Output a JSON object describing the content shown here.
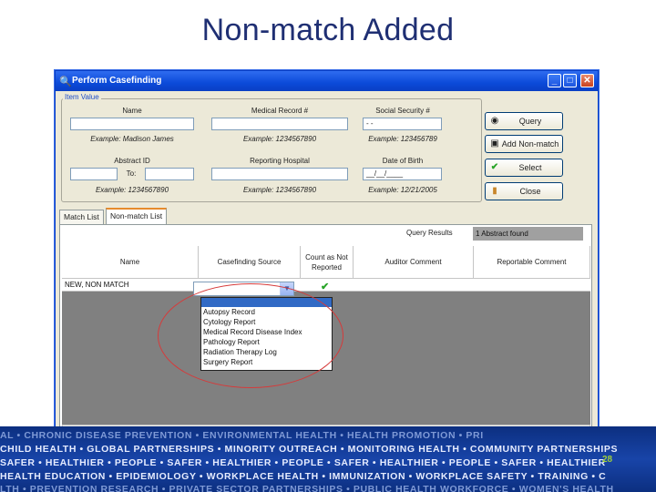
{
  "slide": {
    "title": "Non-match Added",
    "page_number": "28"
  },
  "window": {
    "title": "Perform Casefinding",
    "group_title": "Item Value",
    "labels": {
      "name": "Name",
      "medical_record": "Medical Record #",
      "social_security": "Social Security #",
      "abstract_id": "Abstract ID",
      "reporting_hospital": "Reporting Hospital",
      "date_of_birth": "Date of Birth"
    },
    "examples": {
      "name": "Example: Madison James",
      "medical_record": "Example: 1234567890",
      "social_security": "Example: 123456789",
      "abstract_id": "Example: 1234567890",
      "reporting_hospital": "Example: 1234567890",
      "date_of_birth": "Example: 12/21/2005"
    },
    "fields": {
      "name": "",
      "medical_record": "",
      "social_security": "  -  -",
      "abstract_id": "",
      "abstract_id_to_label": "To:",
      "reporting_hospital": "",
      "date_of_birth": "__/__/____"
    },
    "buttons": {
      "query": "Query",
      "add_non_match": "Add Non-match",
      "select": "Select",
      "close": "Close"
    },
    "tabs": [
      "Match List",
      "Non-match List"
    ],
    "query_results_label": "Query Results",
    "query_results_value": "1 Abstract found",
    "grid": {
      "columns": [
        "Name",
        "Casefinding Source",
        "Count as Not Reported",
        "Auditor Comment",
        "Reportable Comment"
      ],
      "row_name": "NEW, NON MATCH",
      "count_checked": true
    },
    "dropdown_options": [
      "Autopsy Record",
      "Cytology Report",
      "Medical Record Disease Index",
      "Pathology Report",
      "Radiation Therapy Log",
      "Surgery Report"
    ]
  },
  "banner": {
    "lines": [
      "AL • CHRONIC DISEASE PREVENTION • ENVIRONMENTAL HEALTH • HEALTH PROMOTION • PRI",
      "CHILD HEALTH • GLOBAL PARTNERSHIPS • MINORITY OUTREACH • MONITORING HEALTH • COMMUNITY PARTNERSHIPS",
      "SAFER • HEALTHIER • PEOPLE • SAFER • HEALTHIER • PEOPLE • SAFER • HEALTHIER • PEOPLE • SAFER • HEALTHIER",
      "HEALTH EDUCATION • EPIDEMIOLOGY • WORKPLACE HEALTH • IMMUNIZATION • WORKPLACE SAFETY • TRAINING • C",
      "LTH • PREVENTION RESEARCH • PRIVATE SECTOR PARTNERSHIPS • PUBLIC HEALTH WORKFORCE • WOMEN'S HEALTH"
    ]
  }
}
